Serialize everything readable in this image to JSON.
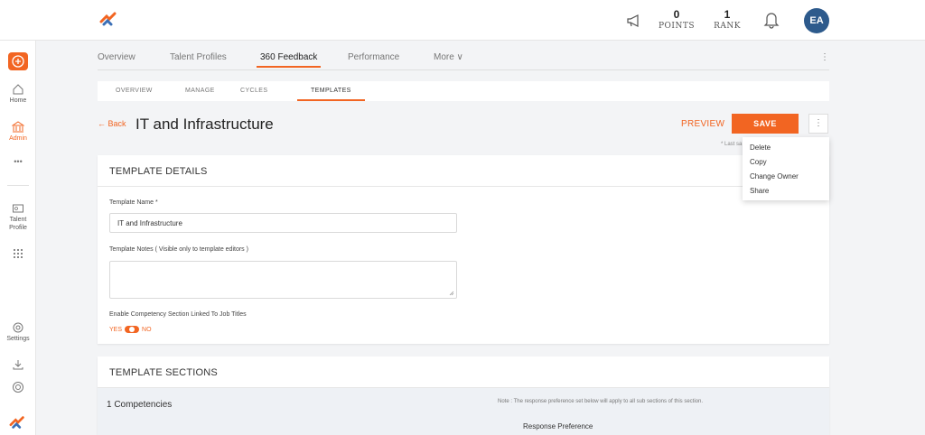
{
  "topbar": {
    "points": {
      "value": "0",
      "label": "POINTS"
    },
    "rank": {
      "value": "1",
      "label": "RANK"
    },
    "avatar_initials": "EA"
  },
  "rail": {
    "home": "Home",
    "admin": "Admin",
    "more": "•••",
    "talent_profile_line1": "Talent",
    "talent_profile_line2": "Profile",
    "settings": "Settings"
  },
  "tabs": {
    "overview": "Overview",
    "talent_profiles": "Talent Profiles",
    "feedback_360": "360 Feedback",
    "performance": "Performance",
    "more": "More ∨",
    "overflow": "⋮"
  },
  "subtabs": {
    "overview": "OVERVIEW",
    "manage": "MANAGE",
    "cycles": "CYCLES",
    "templates": "TEMPLATES"
  },
  "header": {
    "back": "← Back",
    "title": "IT and Infrastructure",
    "preview": "PREVIEW",
    "save": "SAVE",
    "kebab": "⋮",
    "last_saved": "* Last sa"
  },
  "menu": {
    "items": [
      "Delete",
      "Copy",
      "Change Owner",
      "Share"
    ]
  },
  "template_details": {
    "heading": "TEMPLATE DETAILS",
    "name_label": "Template Name *",
    "name_value": "IT and Infrastructure",
    "notes_label": "Template Notes ( Visible only to template editors )",
    "competency_label": "Enable Competency Section Linked To Job Titles",
    "yes": "YES",
    "no": "NO"
  },
  "template_sections": {
    "heading": "TEMPLATE SECTIONS",
    "competencies": "1  Competencies",
    "note": "Note : The response preference set below will apply to all sub sections of this section.",
    "response_preference": "Response Preference"
  },
  "colors": {
    "accent": "#f26522",
    "avatar": "#2d5a8c"
  }
}
